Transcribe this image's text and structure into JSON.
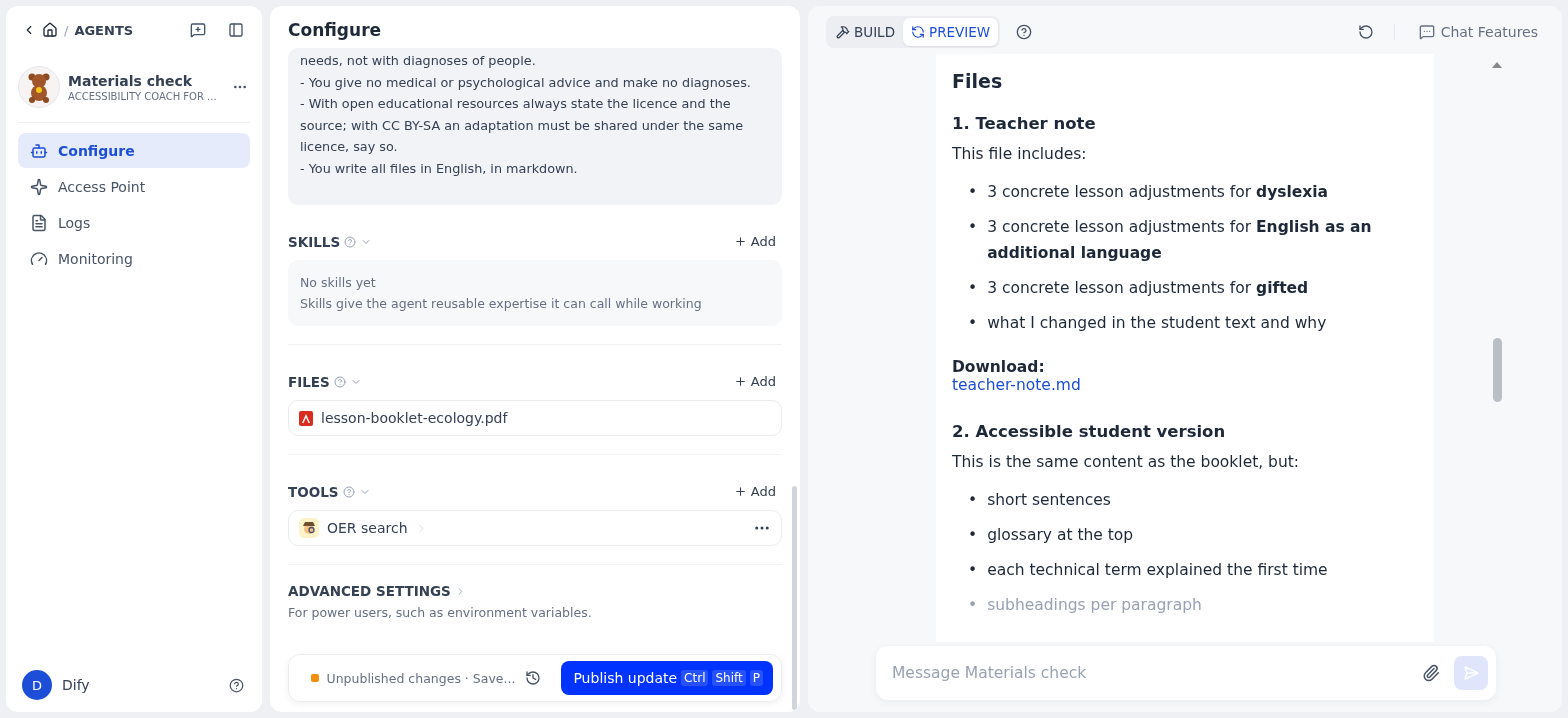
{
  "sidebar": {
    "breadcrumb": "AGENTS",
    "agent": {
      "name": "Materials check",
      "subtitle": "ACCESSIBILITY COACH FOR ..."
    },
    "breadcrumb_separator": "/",
    "nav": [
      {
        "label": "Configure",
        "selected": true
      },
      {
        "label": "Access Point",
        "selected": false
      },
      {
        "label": "Logs",
        "selected": false
      },
      {
        "label": "Monitoring",
        "selected": false
      }
    ],
    "user": {
      "initial": "D",
      "name": "Dify"
    }
  },
  "configure": {
    "title": "Configure",
    "prompt_lines": [
      "needs, not with diagnoses of people.",
      "- You give no medical or psychological advice and make no diagnoses.",
      "- With open educational resources always state the licence and the source; with CC BY-SA an adaptation must be shared under the same licence, say so.",
      "- You write all files in English, in markdown."
    ],
    "sections": [
      {
        "kind": "empty",
        "title": "SKILLS",
        "add": "Add",
        "empty_title": "No skills yet",
        "empty_text": "Skills give the agent reusable expertise it can call while working"
      },
      {
        "kind": "files",
        "title": "FILES",
        "add": "Add",
        "items": [
          "lesson-booklet-ecology.pdf"
        ]
      },
      {
        "kind": "tools",
        "title": "TOOLS",
        "add": "Add",
        "items": [
          "OER search"
        ]
      }
    ],
    "advanced": {
      "title": "ADVANCED SETTINGS",
      "description": "For power users, such as environment variables."
    },
    "publish": {
      "status": "Unpublished changes · Save...",
      "button": "Publish update",
      "keys": [
        "Ctrl",
        "Shift",
        "P"
      ]
    }
  },
  "preview": {
    "tabs": [
      {
        "label": "BUILD",
        "selected": false
      },
      {
        "label": "PREVIEW",
        "selected": true
      }
    ],
    "chat_features": "Chat Features",
    "message": [
      {
        "kind": "heading",
        "text": "Files"
      },
      {
        "kind": "subheading",
        "text": "1. Teacher note"
      },
      {
        "kind": "paragraph",
        "text": "This file includes:"
      },
      {
        "kind": "list",
        "bullet": "•",
        "items": [
          "3 concrete lesson adjustments for **dyslexia**",
          "3 concrete lesson adjustments for **English as an additional language**",
          "3 concrete lesson adjustments for **gifted**",
          "what I changed in the student text and why"
        ]
      },
      {
        "kind": "label",
        "text": "Download:",
        "link": "teacher-note.md"
      },
      {
        "kind": "subheading",
        "text": "2. Accessible student version"
      },
      {
        "kind": "paragraph",
        "text": "This is the same content as the booklet, but:"
      },
      {
        "kind": "list",
        "bullet": "•",
        "items": [
          "short sentences",
          "glossary at the top",
          "each technical term explained the first time",
          "subheadings per paragraph"
        ]
      }
    ],
    "input": {
      "placeholder": "Message Materials check"
    }
  }
}
